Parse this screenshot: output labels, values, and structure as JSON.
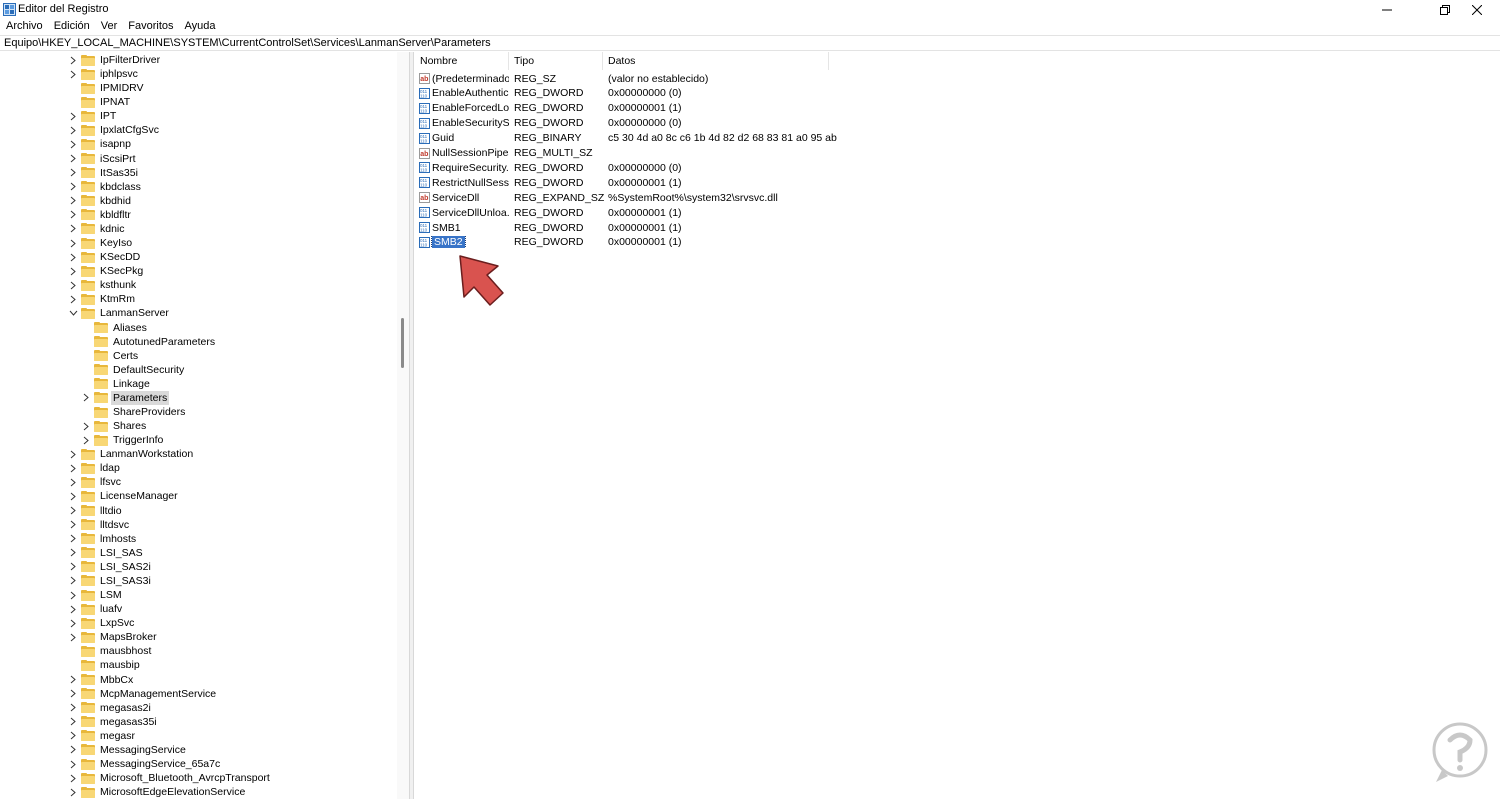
{
  "window": {
    "title": "Editor del Registro"
  },
  "menu": [
    "Archivo",
    "Edición",
    "Ver",
    "Favoritos",
    "Ayuda"
  ],
  "address": "Equipo\\HKEY_LOCAL_MACHINE\\SYSTEM\\CurrentControlSet\\Services\\LanmanServer\\Parameters",
  "tree": [
    {
      "label": "IpFilterDriver",
      "level": 0,
      "expand": "collapsed"
    },
    {
      "label": "iphlpsvc",
      "level": 0,
      "expand": "collapsed"
    },
    {
      "label": "IPMIDRV",
      "level": 0,
      "expand": "none"
    },
    {
      "label": "IPNAT",
      "level": 0,
      "expand": "none"
    },
    {
      "label": "IPT",
      "level": 0,
      "expand": "collapsed"
    },
    {
      "label": "IpxlatCfgSvc",
      "level": 0,
      "expand": "collapsed"
    },
    {
      "label": "isapnp",
      "level": 0,
      "expand": "collapsed"
    },
    {
      "label": "iScsiPrt",
      "level": 0,
      "expand": "collapsed"
    },
    {
      "label": "ItSas35i",
      "level": 0,
      "expand": "collapsed"
    },
    {
      "label": "kbdclass",
      "level": 0,
      "expand": "collapsed"
    },
    {
      "label": "kbdhid",
      "level": 0,
      "expand": "collapsed"
    },
    {
      "label": "kbldfltr",
      "level": 0,
      "expand": "collapsed"
    },
    {
      "label": "kdnic",
      "level": 0,
      "expand": "collapsed"
    },
    {
      "label": "KeyIso",
      "level": 0,
      "expand": "collapsed"
    },
    {
      "label": "KSecDD",
      "level": 0,
      "expand": "collapsed"
    },
    {
      "label": "KSecPkg",
      "level": 0,
      "expand": "collapsed"
    },
    {
      "label": "ksthunk",
      "level": 0,
      "expand": "collapsed"
    },
    {
      "label": "KtmRm",
      "level": 0,
      "expand": "collapsed"
    },
    {
      "label": "LanmanServer",
      "level": 0,
      "expand": "expanded"
    },
    {
      "label": "Aliases",
      "level": 1,
      "expand": "none"
    },
    {
      "label": "AutotunedParameters",
      "level": 1,
      "expand": "none"
    },
    {
      "label": "Certs",
      "level": 1,
      "expand": "none"
    },
    {
      "label": "DefaultSecurity",
      "level": 1,
      "expand": "none"
    },
    {
      "label": "Linkage",
      "level": 1,
      "expand": "none"
    },
    {
      "label": "Parameters",
      "level": 1,
      "expand": "collapsed",
      "selected": true
    },
    {
      "label": "ShareProviders",
      "level": 1,
      "expand": "none"
    },
    {
      "label": "Shares",
      "level": 1,
      "expand": "collapsed"
    },
    {
      "label": "TriggerInfo",
      "level": 1,
      "expand": "collapsed"
    },
    {
      "label": "LanmanWorkstation",
      "level": 0,
      "expand": "collapsed"
    },
    {
      "label": "ldap",
      "level": 0,
      "expand": "collapsed"
    },
    {
      "label": "lfsvc",
      "level": 0,
      "expand": "collapsed"
    },
    {
      "label": "LicenseManager",
      "level": 0,
      "expand": "collapsed"
    },
    {
      "label": "lltdio",
      "level": 0,
      "expand": "collapsed"
    },
    {
      "label": "lltdsvc",
      "level": 0,
      "expand": "collapsed"
    },
    {
      "label": "lmhosts",
      "level": 0,
      "expand": "collapsed"
    },
    {
      "label": "LSI_SAS",
      "level": 0,
      "expand": "collapsed"
    },
    {
      "label": "LSI_SAS2i",
      "level": 0,
      "expand": "collapsed"
    },
    {
      "label": "LSI_SAS3i",
      "level": 0,
      "expand": "collapsed"
    },
    {
      "label": "LSM",
      "level": 0,
      "expand": "collapsed"
    },
    {
      "label": "luafv",
      "level": 0,
      "expand": "collapsed"
    },
    {
      "label": "LxpSvc",
      "level": 0,
      "expand": "collapsed"
    },
    {
      "label": "MapsBroker",
      "level": 0,
      "expand": "collapsed"
    },
    {
      "label": "mausbhost",
      "level": 0,
      "expand": "none"
    },
    {
      "label": "mausbip",
      "level": 0,
      "expand": "none"
    },
    {
      "label": "MbbCx",
      "level": 0,
      "expand": "collapsed"
    },
    {
      "label": "McpManagementService",
      "level": 0,
      "expand": "collapsed"
    },
    {
      "label": "megasas2i",
      "level": 0,
      "expand": "collapsed"
    },
    {
      "label": "megasas35i",
      "level": 0,
      "expand": "collapsed"
    },
    {
      "label": "megasr",
      "level": 0,
      "expand": "collapsed"
    },
    {
      "label": "MessagingService",
      "level": 0,
      "expand": "collapsed"
    },
    {
      "label": "MessagingService_65a7c",
      "level": 0,
      "expand": "collapsed"
    },
    {
      "label": "Microsoft_Bluetooth_AvrcpTransport",
      "level": 0,
      "expand": "collapsed"
    },
    {
      "label": "MicrosoftEdgeElevationService",
      "level": 0,
      "expand": "collapsed"
    }
  ],
  "list": {
    "columns": [
      "Nombre",
      "Tipo",
      "Datos"
    ],
    "rows": [
      {
        "icon": "string-value-icon",
        "name": "(Predeterminado)",
        "type": "REG_SZ",
        "data": "(valor no establecido)"
      },
      {
        "icon": "binary-value-icon",
        "name": "EnableAuthentic...",
        "type": "REG_DWORD",
        "data": "0x00000000 (0)"
      },
      {
        "icon": "binary-value-icon",
        "name": "EnableForcedLo...",
        "type": "REG_DWORD",
        "data": "0x00000001 (1)"
      },
      {
        "icon": "binary-value-icon",
        "name": "EnableSecuritySi...",
        "type": "REG_DWORD",
        "data": "0x00000000 (0)"
      },
      {
        "icon": "binary-value-icon",
        "name": "Guid",
        "type": "REG_BINARY",
        "data": "c5 30 4d a0 8c c6 1b 4d 82 d2 68 83 81 a0 95 ab"
      },
      {
        "icon": "string-value-icon",
        "name": "NullSessionPipes",
        "type": "REG_MULTI_SZ",
        "data": ""
      },
      {
        "icon": "binary-value-icon",
        "name": "RequireSecurity...",
        "type": "REG_DWORD",
        "data": "0x00000000 (0)"
      },
      {
        "icon": "binary-value-icon",
        "name": "RestrictNullSess...",
        "type": "REG_DWORD",
        "data": "0x00000001 (1)"
      },
      {
        "icon": "string-value-icon",
        "name": "ServiceDll",
        "type": "REG_EXPAND_SZ",
        "data": "%SystemRoot%\\system32\\srvsvc.dll"
      },
      {
        "icon": "binary-value-icon",
        "name": "ServiceDllUnloa...",
        "type": "REG_DWORD",
        "data": "0x00000001 (1)"
      },
      {
        "icon": "binary-value-icon",
        "name": "SMB1",
        "type": "REG_DWORD",
        "data": "0x00000001 (1)"
      },
      {
        "icon": "binary-value-icon",
        "name": "SMB2",
        "type": "REG_DWORD",
        "data": "0x00000001 (1)",
        "selected": true
      }
    ]
  },
  "colors": {
    "folder": "#f8d775",
    "selection": "#3874c8",
    "arrow": "#d9534f"
  }
}
